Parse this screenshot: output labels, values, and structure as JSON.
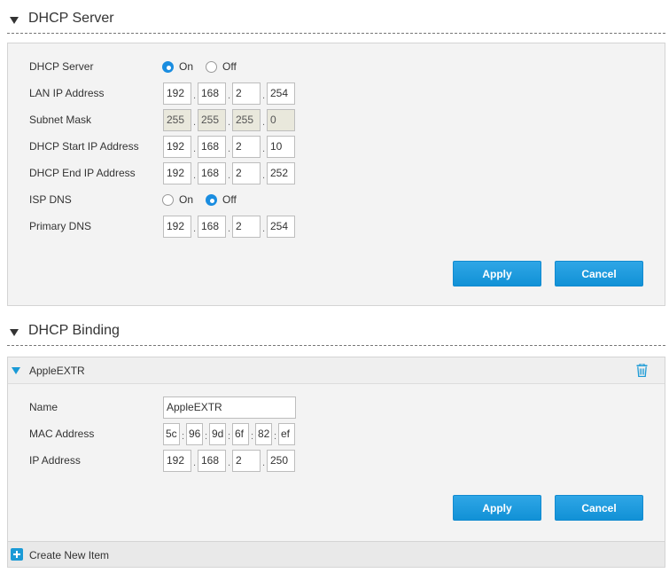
{
  "dhcp_server": {
    "title": "DHCP Server",
    "fields": {
      "server_label": "DHCP Server",
      "server_on": "On",
      "server_off": "Off",
      "lan_label": "LAN IP Address",
      "lan_ip": [
        "192",
        "168",
        "2",
        "254"
      ],
      "subnet_label": "Subnet Mask",
      "subnet": [
        "255",
        "255",
        "255",
        "0"
      ],
      "start_label": "DHCP Start IP Address",
      "start_ip": [
        "192",
        "168",
        "2",
        "10"
      ],
      "end_label": "DHCP End IP Address",
      "end_ip": [
        "192",
        "168",
        "2",
        "252"
      ],
      "isp_label": "ISP DNS",
      "isp_on": "On",
      "isp_off": "Off",
      "dns_label": "Primary DNS",
      "dns": [
        "192",
        "168",
        "2",
        "254"
      ]
    },
    "apply_label": "Apply",
    "cancel_label": "Cancel"
  },
  "dhcp_binding": {
    "title": "DHCP Binding",
    "item_name": "AppleEXTR",
    "name_label": "Name",
    "name_value": "AppleEXTR",
    "mac_label": "MAC Address",
    "mac": [
      "5c",
      "96",
      "9d",
      "6f",
      "82",
      "ef"
    ],
    "ip_label": "IP Address",
    "ip": [
      "192",
      "168",
      "2",
      "250"
    ],
    "apply_label": "Apply",
    "cancel_label": "Cancel",
    "create_label": "Create New Item"
  },
  "colors": {
    "accent": "#1a8de0",
    "button": "#1a9ad6"
  }
}
